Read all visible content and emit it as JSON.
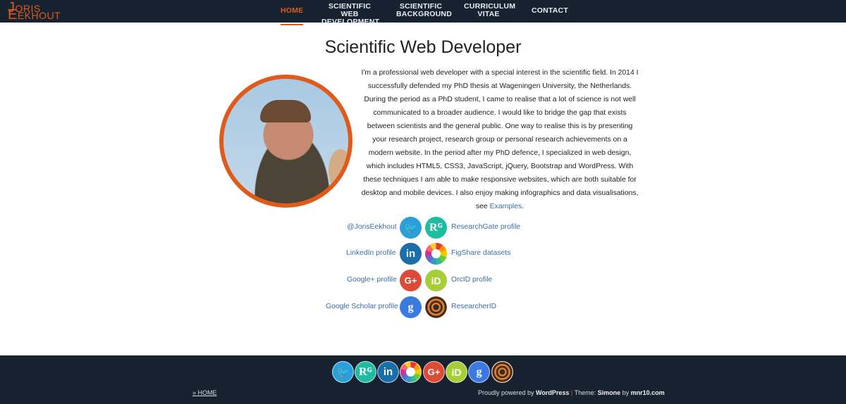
{
  "site": {
    "logo_line1_first": "J",
    "logo_line1_rest": "ORIS",
    "logo_line2_first": "E",
    "logo_line2_rest": "EKHOUT",
    "accent_color": "#e05a1a",
    "header_bg": "#16222f"
  },
  "nav": {
    "items": [
      {
        "label": "HOME",
        "active": true
      },
      {
        "label": "SCIENTIFIC WEB\nDEVELOPMENT",
        "active": false
      },
      {
        "label": "SCIENTIFIC\nBACKGROUND",
        "active": false
      },
      {
        "label": "CURRICULUM\nVITAE",
        "active": false
      },
      {
        "label": "CONTACT",
        "active": false
      }
    ]
  },
  "main": {
    "title": "Scientific Web Developer",
    "intro_text": "I'm a professional web developer with a special interest in the scientific field. In 2014 I successfully defended my PhD thesis at Wageningen University, the Netherlands. During the period as a PhD student, I came to realise that a lot of science is not well communicated to a broader audience. I would like to bridge the gap that exists between scientists and the general public. One way to realise this is by presenting your research project, research group or personal research achievements on a modern website. In the period after my PhD defence, I specialized in web design, which includes HTML5, CSS3, JavaScript, jQuery, Bootstrap and WordPress. With these techniques I am able to make responsive websites, which are both suitable for desktop and mobile devices. I also enjoy making infographics and data visualisations, see ",
    "intro_link": "Examples",
    "intro_end": "."
  },
  "profiles": {
    "left": [
      {
        "label": "@JorisEekhout",
        "icon": "twitter-icon",
        "glyph": "🐦"
      },
      {
        "label": "LinkedIn profile",
        "icon": "linkedin-icon",
        "glyph": "in"
      },
      {
        "label": "Google+ profile",
        "icon": "google-plus-icon",
        "glyph": "G+"
      },
      {
        "label": "Google Scholar profile",
        "icon": "google-scholar-icon",
        "glyph": "g"
      }
    ],
    "right": [
      {
        "label": "ResearchGate profile",
        "icon": "researchgate-icon",
        "glyph": "Rᴳ"
      },
      {
        "label": "FigShare datasets",
        "icon": "figshare-icon",
        "glyph": ""
      },
      {
        "label": "OrcID profile",
        "icon": "orcid-icon",
        "glyph": "iD"
      },
      {
        "label": "ResearcherID",
        "icon": "researcherid-icon",
        "glyph": ""
      }
    ]
  },
  "footer": {
    "icons": [
      {
        "icon": "twitter-icon",
        "glyph": "🐦"
      },
      {
        "icon": "researchgate-icon",
        "glyph": "Rᴳ"
      },
      {
        "icon": "linkedin-icon",
        "glyph": "in"
      },
      {
        "icon": "figshare-icon",
        "glyph": ""
      },
      {
        "icon": "google-plus-icon",
        "glyph": "G+"
      },
      {
        "icon": "orcid-icon",
        "glyph": "iD"
      },
      {
        "icon": "google-scholar-icon",
        "glyph": "g"
      },
      {
        "icon": "researcherid-icon",
        "glyph": ""
      }
    ],
    "breadcrumb": "» HOME",
    "credits_prefix": "Proudly powered by ",
    "credits_wp": "WordPress",
    "credits_sep": " | ",
    "credits_theme": "Theme: ",
    "credits_theme_name": "Simone",
    "credits_by": " by ",
    "credits_author": "mnr10.com"
  }
}
